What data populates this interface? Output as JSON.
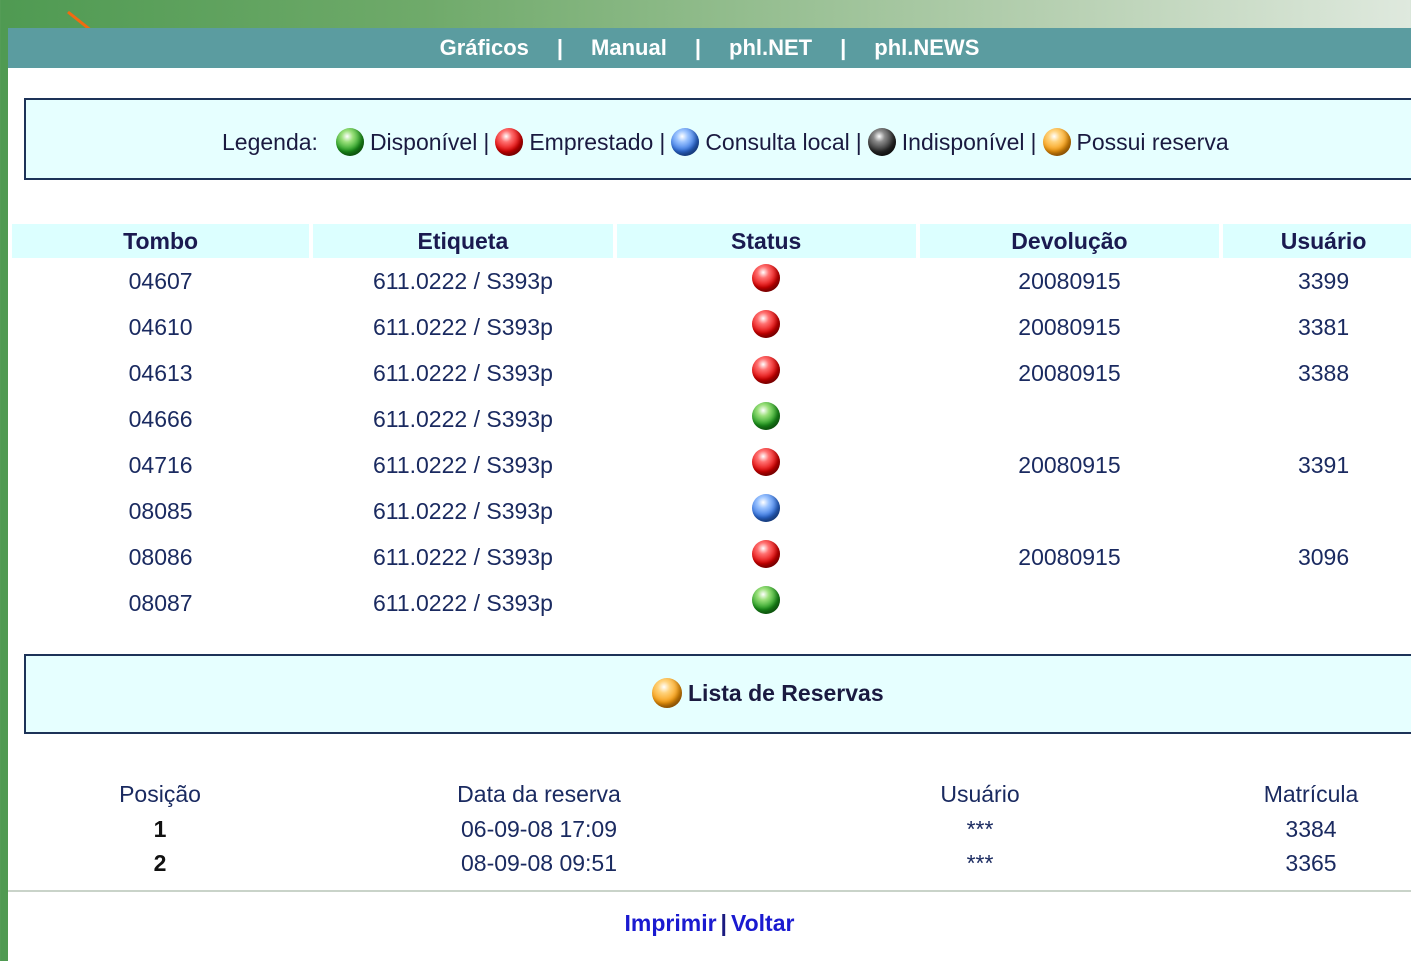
{
  "nav": {
    "items": [
      "Gráficos",
      "Manual",
      "phl.NET",
      "phl.NEWS"
    ],
    "separator": "|"
  },
  "legend": {
    "heading": "Legenda:",
    "items": [
      {
        "label": "Disponível",
        "color": "green"
      },
      {
        "label": "Emprestado",
        "color": "red"
      },
      {
        "label": "Consulta local",
        "color": "blue"
      },
      {
        "label": "Indisponível",
        "color": "black"
      },
      {
        "label": "Possui reserva",
        "color": "orange"
      }
    ],
    "separator": "|"
  },
  "copies": {
    "headers": [
      "Tombo",
      "Etiqueta",
      "Status",
      "Devolução",
      "Usuário"
    ],
    "rows": [
      {
        "tombo": "04607",
        "etiqueta": "611.0222 / S393p",
        "status": "red",
        "devolucao": "20080915",
        "usuario": "3399"
      },
      {
        "tombo": "04610",
        "etiqueta": "611.0222 / S393p",
        "status": "red",
        "devolucao": "20080915",
        "usuario": "3381"
      },
      {
        "tombo": "04613",
        "etiqueta": "611.0222 / S393p",
        "status": "red",
        "devolucao": "20080915",
        "usuario": "3388"
      },
      {
        "tombo": "04666",
        "etiqueta": "611.0222 / S393p",
        "status": "green",
        "devolucao": "",
        "usuario": ""
      },
      {
        "tombo": "04716",
        "etiqueta": "611.0222 / S393p",
        "status": "red",
        "devolucao": "20080915",
        "usuario": "3391"
      },
      {
        "tombo": "08085",
        "etiqueta": "611.0222 / S393p",
        "status": "blue",
        "devolucao": "",
        "usuario": ""
      },
      {
        "tombo": "08086",
        "etiqueta": "611.0222 / S393p",
        "status": "red",
        "devolucao": "20080915",
        "usuario": "3096"
      },
      {
        "tombo": "08087",
        "etiqueta": "611.0222 / S393p",
        "status": "green",
        "devolucao": "",
        "usuario": ""
      }
    ]
  },
  "reservations": {
    "title": "Lista de Reservas",
    "headers": [
      "Posição",
      "Data da reserva",
      "Usuário",
      "Matrícula"
    ],
    "rows": [
      {
        "posicao": "1",
        "data": "06-09-08 17:09",
        "usuario": "***",
        "matricula": "3384"
      },
      {
        "posicao": "2",
        "data": "08-09-08 09:51",
        "usuario": "***",
        "matricula": "3365"
      }
    ]
  },
  "footer": {
    "print_label": "Imprimir",
    "back_label": "Voltar",
    "separator": "|"
  },
  "colors": {
    "nav_bg": "#5b9ca0",
    "box_bg": "#e6ffff",
    "arrow": "#f26a10",
    "link": "#1a1ad0"
  }
}
